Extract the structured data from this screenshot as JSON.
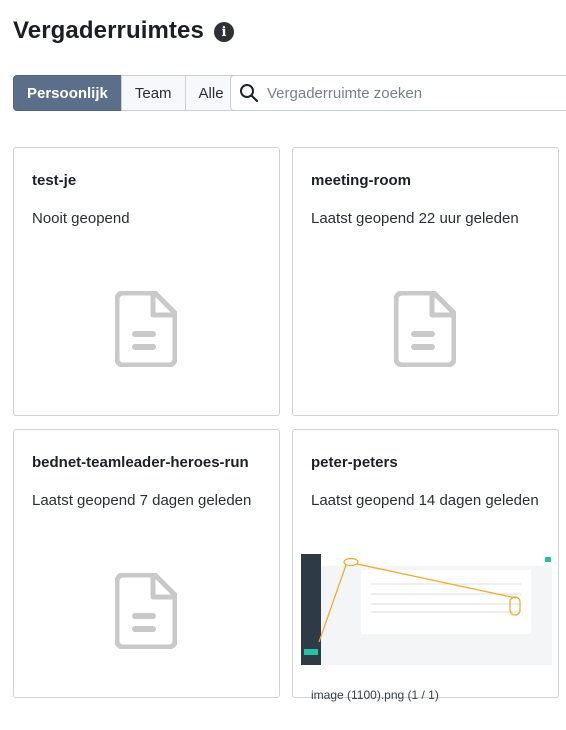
{
  "header": {
    "title": "Vergaderruimtes",
    "info_icon": "info-icon"
  },
  "filters": [
    {
      "label": "Persoonlijk",
      "active": true
    },
    {
      "label": "Team",
      "active": false
    },
    {
      "label": "Alle",
      "active": false
    }
  ],
  "search": {
    "placeholder": "Vergaderruimte zoeken",
    "value": "",
    "icon": "search-icon"
  },
  "rooms": [
    {
      "title": "test-je",
      "subtitle": "Nooit geopend",
      "preview": "document-icon"
    },
    {
      "title": "meeting-room",
      "subtitle": "Laatst geopend 22 uur geleden",
      "preview": "document-icon"
    },
    {
      "title": "bednet-teamleader-heroes-run",
      "subtitle": "Laatst geopend 7 dagen geleden",
      "preview": "document-icon"
    },
    {
      "title": "peter-peters",
      "subtitle": "Laatst geopend 14 dagen geleden",
      "preview": "image-thumbnail",
      "caption": "image (1100).png (1 / 1)"
    }
  ],
  "colors": {
    "active_filter": "#5c6f8a",
    "placeholder_icon": "#c9c9c9",
    "annotation": "#f5a623",
    "thumb_sidebar": "#2e3b47",
    "thumb_accent": "#27c2a3"
  }
}
